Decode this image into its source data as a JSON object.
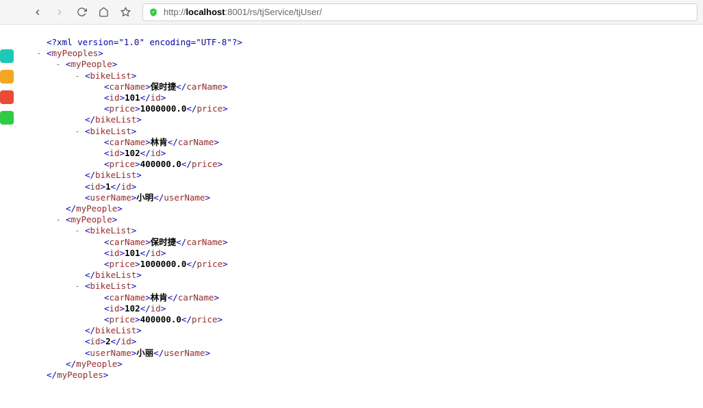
{
  "toolbar": {
    "url_prefix": "http://",
    "url_host": "localhost",
    "url_port": ":8001",
    "url_path": "/rs/tjService/tjUser/"
  },
  "xml": {
    "declaration": "<?xml version=\"1.0\" encoding=\"UTF-8\"?>",
    "root": "myPeoples",
    "people": [
      {
        "tag": "myPeople",
        "bikes": [
          {
            "tag": "bikeList",
            "carName": "保时捷",
            "id": "101",
            "price": "1000000.0"
          },
          {
            "tag": "bikeList",
            "carName": "林肯",
            "id": "102",
            "price": "400000.0"
          }
        ],
        "id": "1",
        "userName": "小明"
      },
      {
        "tag": "myPeople",
        "bikes": [
          {
            "tag": "bikeList",
            "carName": "保时捷",
            "id": "101",
            "price": "1000000.0"
          },
          {
            "tag": "bikeList",
            "carName": "林肯",
            "id": "102",
            "price": "400000.0"
          }
        ],
        "id": "2",
        "userName": "小丽"
      }
    ],
    "labels": {
      "carName": "carName",
      "id": "id",
      "price": "price",
      "userName": "userName"
    }
  },
  "side_apps": [
    {
      "color": "#1ec9b7"
    },
    {
      "color": "#f5a623"
    },
    {
      "color": "#e94b35"
    },
    {
      "color": "#2ecc40"
    }
  ]
}
